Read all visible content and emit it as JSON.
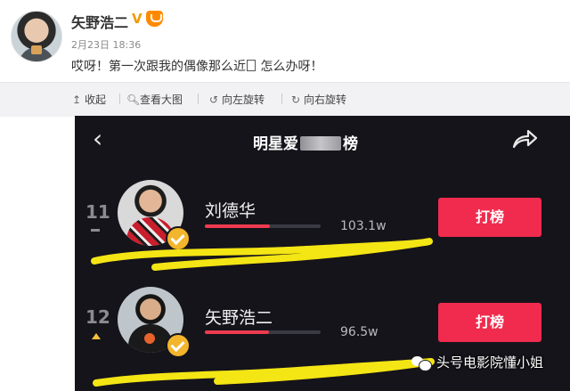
{
  "post": {
    "username": "矢野浩二",
    "verified_badge": "V",
    "date": "2月23日",
    "time": "18:36",
    "text": "哎呀！第一次跟我的偶像那么近",
    "text_after": " 怎么办呀！"
  },
  "toolbar": {
    "collapse": "收起",
    "view_large": "查看大图",
    "rotate_left": "向左旋转",
    "rotate_right": "向右旋转"
  },
  "screenshot": {
    "title_left": "明星爱",
    "title_right": "榜",
    "accent": "#f02b4e",
    "entries": [
      {
        "rank": "11",
        "name": "刘德华",
        "votes": "103.1w",
        "button": "打榜",
        "progress": 0.56
      },
      {
        "rank": "12",
        "name": "矢野浩二",
        "votes": "96.5w",
        "button": "打榜",
        "progress": 0.55
      }
    ]
  },
  "watermark": "头号电影院懂小姐"
}
